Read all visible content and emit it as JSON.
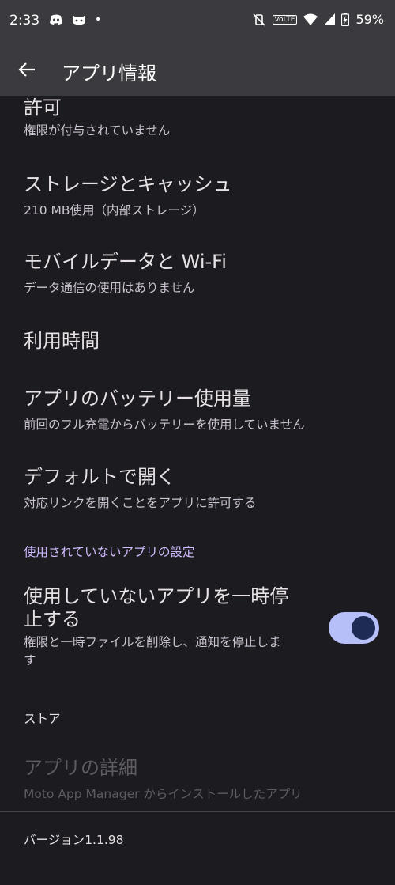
{
  "status_bar": {
    "time": "2:33",
    "dot": "•",
    "volte": "VoLTE",
    "battery": "59%"
  },
  "appbar": {
    "title": "アプリ情報",
    "back_icon": "arrow-back-icon"
  },
  "items": [
    {
      "title": "許可",
      "subtitle": "権限が付与されていません"
    },
    {
      "title": "ストレージとキャッシュ",
      "subtitle": "210 MB使用（内部ストレージ）"
    },
    {
      "title": "モバイルデータと Wi-Fi",
      "subtitle": "データ通信の使用はありません"
    },
    {
      "title": "利用時間"
    },
    {
      "title": "アプリのバッテリー使用量",
      "subtitle": "前回のフル充電からバッテリーを使用していません"
    },
    {
      "title": "デフォルトで開く",
      "subtitle": "対応リンクを開くことをアプリに許可する"
    }
  ],
  "unused_section": {
    "header": "使用されていないアプリの設定",
    "title_line1": "使用していないアプリを一時停",
    "title_line2": "止する",
    "subtitle_line1": "権限と一時ファイルを削除し、通知を停止しま",
    "subtitle_line2": "す",
    "toggle_on": true
  },
  "store_section": {
    "header": "ストア",
    "title": "アプリの詳細",
    "subtitle": "Moto App Manager からインストールしたアプリ"
  },
  "version": "バージョン1.1.98",
  "colors": {
    "background": "#1c1b1f",
    "appbar": "#3b3a3e",
    "accent": "#d0bcff",
    "toggle_track": "#b6bff8",
    "toggle_thumb": "#1e2b54"
  }
}
